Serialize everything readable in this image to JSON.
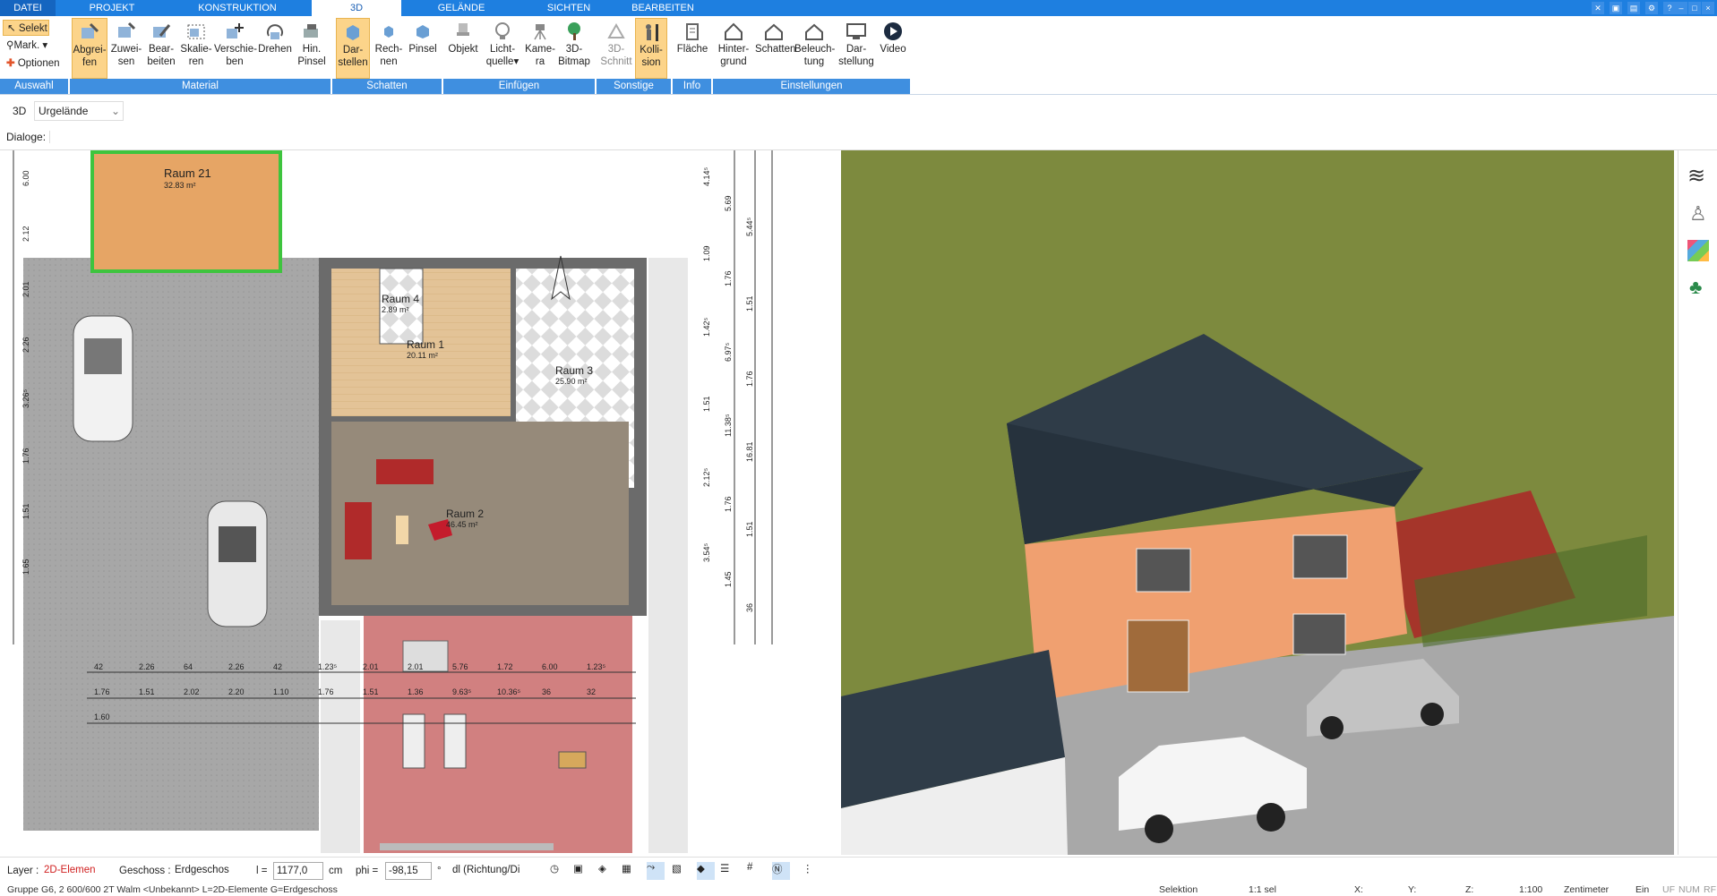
{
  "menu": {
    "tabs": [
      "DATEI",
      "PROJEKT",
      "KONSTRUKTION",
      "3D",
      "GELÄNDE",
      "SICHTEN",
      "BEARBEITEN"
    ],
    "active": "3D"
  },
  "ribbon": {
    "auswahl": {
      "selekt": "Selekt",
      "mark": "Mark.",
      "optionen": "Optionen",
      "group": "Auswahl"
    },
    "material": {
      "buttons": [
        [
          "Abgrei-",
          "fen"
        ],
        [
          "Zuwei-",
          "sen"
        ],
        [
          "Bear-",
          "beiten"
        ],
        [
          "Skalie-",
          "ren"
        ],
        [
          "Verschie-",
          "ben"
        ],
        [
          "Drehen",
          ""
        ],
        [
          "Hin.",
          "Pinsel"
        ]
      ],
      "group": "Material"
    },
    "schatten": {
      "buttons": [
        [
          "Dar-",
          "stellen"
        ],
        [
          "Rech-",
          "nen"
        ],
        [
          "Pinsel",
          ""
        ]
      ],
      "group": "Schatten"
    },
    "einfuegen": {
      "buttons": [
        [
          "Objekt",
          ""
        ],
        [
          "Licht-",
          "quelle"
        ],
        [
          "Kame-",
          "ra"
        ],
        [
          "3D-",
          "Bitmap"
        ]
      ],
      "group": "Einfügen"
    },
    "sonstige": {
      "buttons": [
        [
          "3D-",
          "Schnitt"
        ],
        [
          "Kolli-",
          "sion"
        ]
      ],
      "group": "Sonstige"
    },
    "info": {
      "buttons": [
        [
          "Fläche",
          ""
        ]
      ],
      "group": "Info"
    },
    "einstellungen": {
      "buttons": [
        [
          "Hinter-",
          "grund"
        ],
        [
          "Schatten",
          ""
        ],
        [
          "Beleuch-",
          "tung"
        ],
        [
          "Dar-",
          "stellung"
        ],
        [
          "Video",
          ""
        ]
      ],
      "group": "Einstellungen"
    }
  },
  "toolbar2": {
    "mode": "3D",
    "terrain": "Urgelände"
  },
  "dialoge": "Dialoge:",
  "plan": {
    "rooms": [
      {
        "name": "Raum 21",
        "area": "32.83 m²"
      },
      {
        "name": "Raum 4",
        "area": "2.89 m²"
      },
      {
        "name": "Raum 1",
        "area": "20.11 m²"
      },
      {
        "name": "Raum 3",
        "area": "25.90 m²"
      },
      {
        "name": "Raum 2",
        "area": "46.45 m²"
      }
    ],
    "dims_bottom": [
      "42",
      "2.26",
      "64",
      "2.26",
      "42",
      "1.23⁵",
      "2.01",
      "2.01",
      "5.76",
      "1.72",
      "6.00",
      "1.23⁵",
      "1.76",
      "1.51",
      "2.02",
      "2.20",
      "1.10",
      "1.76",
      "1.51",
      "1.36",
      "9.63⁵",
      "10.36⁵",
      "36",
      "32",
      "1.60"
    ],
    "dims_right": [
      "4.14⁵",
      "5.69",
      "5.44⁵",
      "1.09",
      "1.76",
      "1.51",
      "1.42⁵",
      "6.97⁵",
      "1.76",
      "1.51",
      "11.38⁵",
      "16.81",
      "2.12⁵",
      "1.76",
      "1.51",
      "3.54⁵",
      "1.45",
      "36"
    ],
    "dims_left": [
      "6.00",
      "2.12",
      "2.01",
      "2.26",
      "3.26⁵",
      "1.76",
      "1.51",
      "1.65"
    ]
  },
  "statusbar": {
    "layer_label": "Layer :",
    "layer_value": "2D-Elemen",
    "geschoss_label": "Geschoss :",
    "geschoss_value": "Erdgeschos",
    "l_label": "l =",
    "l_value": "1177,0",
    "l_unit": "cm",
    "phi_label": "phi =",
    "phi_value": "-98,15",
    "phi_unit": "°",
    "dl_value": "dl (Richtung/Di"
  },
  "bottom": {
    "info": "Gruppe G6, 2 600/600 2T Walm <Unbekannt> L=2D-Elemente G=Erdgeschoss",
    "selektion": "Selektion",
    "sel": "1:1 sel",
    "x": "X:",
    "y": "Y:",
    "z": "Z:",
    "scale": "1:100",
    "unit": "Zentimeter",
    "ein": "Ein",
    "uf": "UF",
    "num": "NUM",
    "rf": "RF"
  },
  "colors": {
    "accent": "#1e7fe0",
    "group": "#3f8fe0",
    "selected": "#fcd48a",
    "grass": "#7d8a3e",
    "wall": "#f0a070",
    "roof": "#2f3c48",
    "terrace": "#b53a2c"
  }
}
